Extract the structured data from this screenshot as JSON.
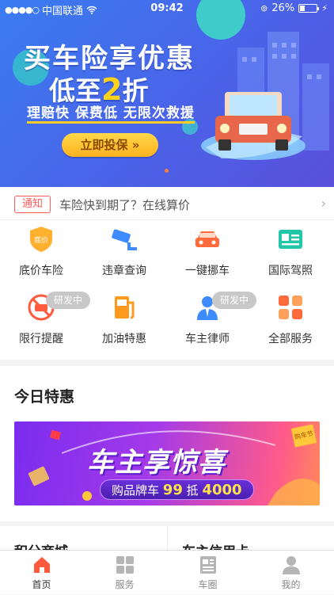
{
  "status_bar": {
    "carrier": "中国联通",
    "time": "09:42",
    "battery": "26%"
  },
  "banner": {
    "title": "买车险享优惠",
    "sub_prefix": "低至",
    "sub_number": "2",
    "sub_suffix": "折",
    "tagline": "理赔快  保费低  无限次救援",
    "button": "立即投保 »"
  },
  "notice": {
    "tag": "通知",
    "text": "车险快到期了？在线算价"
  },
  "services": [
    {
      "label": "底价车险",
      "icon": "insurance-shield-icon",
      "icon_text": "底价",
      "color": "#ff9a1f"
    },
    {
      "label": "违章查询",
      "icon": "traffic-camera-icon",
      "color": "#3d8bff"
    },
    {
      "label": "一键挪车",
      "icon": "car-move-icon",
      "color": "#ff6a3d"
    },
    {
      "label": "国际驾照",
      "icon": "driver-license-icon",
      "color": "#21c7a8"
    },
    {
      "label": "限行提醒",
      "icon": "no-car-icon",
      "badge": "研发中",
      "color": "#ff5a3d"
    },
    {
      "label": "加油特惠",
      "icon": "fuel-pump-icon",
      "color": "#ff9a1f"
    },
    {
      "label": "车主律师",
      "icon": "lawyer-icon",
      "badge": "研发中",
      "color": "#3d8bff"
    },
    {
      "label": "全部服务",
      "icon": "all-services-icon",
      "color": "#ff6a3d"
    }
  ],
  "today": {
    "title": "今日特惠",
    "promo_title": "车主享惊喜",
    "promo_sub_prefix": "购品牌车",
    "promo_sub_bold1": "99",
    "promo_sub_mid": "抵",
    "promo_sub_bold2": "4000",
    "promo_stamp": "购车节"
  },
  "bottom_cards": {
    "left": "积分商城",
    "right": "车主信用卡"
  },
  "tabs": [
    {
      "label": "首页",
      "icon": "home-icon",
      "active": true
    },
    {
      "label": "服务",
      "icon": "grid-icon",
      "active": false
    },
    {
      "label": "车圈",
      "icon": "newspaper-icon",
      "active": false
    },
    {
      "label": "我的",
      "icon": "person-icon",
      "active": false
    }
  ]
}
